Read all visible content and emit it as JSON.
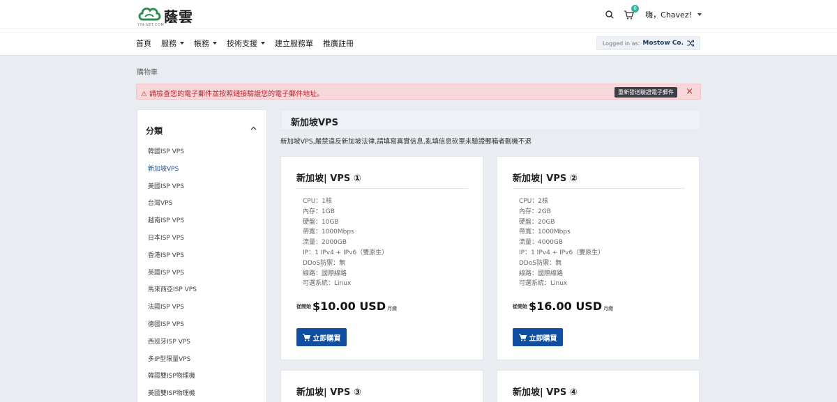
{
  "brand": {
    "name": "蔭雲",
    "sub": "YIN-NET.COM",
    "color": "#2e8b4f"
  },
  "header": {
    "cart_count": "0",
    "greeting": "嗨，Chavez!",
    "icons": [
      "search-icon",
      "cart-icon"
    ]
  },
  "nav": {
    "items": [
      {
        "label": "首頁",
        "dropdown": false
      },
      {
        "label": "服務",
        "dropdown": true
      },
      {
        "label": "帳務",
        "dropdown": true
      },
      {
        "label": "技術支援",
        "dropdown": true
      },
      {
        "label": "建立服務單",
        "dropdown": false
      },
      {
        "label": "推廣註冊",
        "dropdown": false
      }
    ],
    "logged_in_label": "Logged in as:",
    "logged_in_name": "Mostow Co."
  },
  "breadcrumb": "購物車",
  "alert": {
    "text": "⚠ 請檢查您的電子郵件並按照鏈接驗證您的電子郵件地址。",
    "button": "重新發送驗證電子郵件",
    "close": "×"
  },
  "sidebar": {
    "heading": "分類",
    "items": [
      {
        "label": "韓國ISP VPS",
        "active": false
      },
      {
        "label": "新加坡VPS",
        "active": true
      },
      {
        "label": "美國ISP VPS",
        "active": false
      },
      {
        "label": "台灣VPS",
        "active": false
      },
      {
        "label": "越南ISP VPS",
        "active": false
      },
      {
        "label": "日本ISP VPS",
        "active": false
      },
      {
        "label": "香港ISP VPS",
        "active": false
      },
      {
        "label": "英國ISP VPS",
        "active": false
      },
      {
        "label": "馬來西亞ISP VPS",
        "active": false
      },
      {
        "label": "法國ISP VPS",
        "active": false
      },
      {
        "label": "德國ISP VPS",
        "active": false
      },
      {
        "label": "西班牙ISP VPS",
        "active": false
      },
      {
        "label": "多IP型限量VPS",
        "active": false
      },
      {
        "label": "韓國雙ISP物理機",
        "active": false
      },
      {
        "label": "美國雙ISP物理機",
        "active": false
      }
    ]
  },
  "category": {
    "title": "新加坡VPS",
    "description": "新加坡VPS,嚴禁違反新加坡法律,請填寫真實信息,亂填信息砍單未驗證郵箱者刪機不退"
  },
  "products": [
    {
      "name": "新加坡| VPS ①",
      "specs": [
        "CPU：1核",
        "內存：1GB",
        "硬盤：10GB",
        "帶寬：1000Mbps",
        "流量：2000GB",
        "IP：1 IPv4 + IPv6（雙原生）",
        "DDoS防禦：無",
        "線路：國際線路",
        "可選系統：Linux"
      ],
      "price_from": "從開始",
      "price": "$10.00 USD",
      "cycle": "月繳",
      "button": "立即購買"
    },
    {
      "name": "新加坡| VPS ②",
      "specs": [
        "CPU：2核",
        "內存：2GB",
        "硬盤：20GB",
        "帶寬：1000Mbps",
        "流量：4000GB",
        "IP：1 IPv4 + IPv6（雙原生）",
        "DDoS防禦：無",
        "線路：國際線路",
        "可選系統：Linux"
      ],
      "price_from": "從開始",
      "price": "$16.00 USD",
      "cycle": "月繳",
      "button": "立即購買"
    },
    {
      "name": "新加坡| VPS ③"
    },
    {
      "name": "新加坡| VPS ④"
    }
  ],
  "colors": {
    "accent": "#104e9f",
    "alert_bg": "#f8d7da",
    "alert_text": "#c0242f",
    "badge": "#3ab09e"
  }
}
